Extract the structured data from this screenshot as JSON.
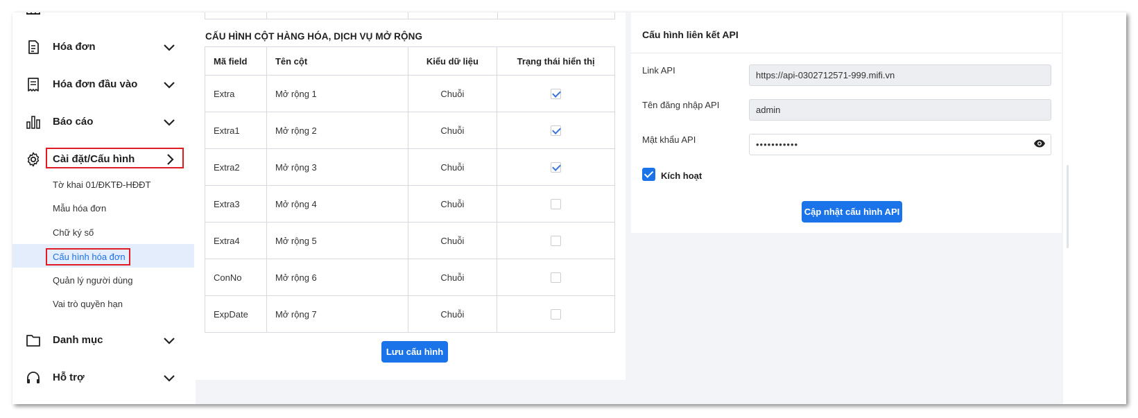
{
  "sidebar": {
    "partial_top_label": "...",
    "items": [
      {
        "label": "Hóa đơn",
        "icon": "receipt-icon"
      },
      {
        "label": "Hóa đơn đầu vào",
        "icon": "invoice-input-icon"
      },
      {
        "label": "Báo cáo",
        "icon": "bar-chart-icon"
      },
      {
        "label": "Cài đặt/Cấu hình",
        "icon": "gear-icon"
      },
      {
        "label": "Danh mục",
        "icon": "folder-icon"
      },
      {
        "label": "Hỗ trợ",
        "icon": "headset-icon"
      }
    ],
    "sub_items": [
      "Tờ khai 01/ĐKTĐ-HĐĐT",
      "Mẫu hóa đơn",
      "Chữ ký số",
      "Cấu hình hóa đơn",
      "Quản lý người dùng",
      "Vai trò quyền hạn"
    ],
    "active_sub_item": "Cấu hình hóa đơn"
  },
  "extended_columns": {
    "title": "CẤU HÌNH CỘT HÀNG HÓA, DỊCH VỤ MỞ RỘNG",
    "headers": [
      "Mã field",
      "Tên cột",
      "Kiểu dữ liệu",
      "Trạng thái hiển thị"
    ],
    "rows": [
      {
        "field": "Extra",
        "name": "Mở rộng 1",
        "type": "Chuỗi",
        "visible": true
      },
      {
        "field": "Extra1",
        "name": "Mở rộng 2",
        "type": "Chuỗi",
        "visible": true
      },
      {
        "field": "Extra2",
        "name": "Mở rộng 3",
        "type": "Chuỗi",
        "visible": true
      },
      {
        "field": "Extra3",
        "name": "Mở rộng 4",
        "type": "Chuỗi",
        "visible": false
      },
      {
        "field": "Extra4",
        "name": "Mở rộng 5",
        "type": "Chuỗi",
        "visible": false
      },
      {
        "field": "ConNo",
        "name": "Mở rộng 6",
        "type": "Chuỗi",
        "visible": false
      },
      {
        "field": "ExpDate",
        "name": "Mở rộng 7",
        "type": "Chuỗi",
        "visible": false
      }
    ],
    "save_button": "Lưu cấu hình"
  },
  "api_config": {
    "title": "Cấu hình liên kết API",
    "link_label": "Link API",
    "link_value": "https://api-0302712571-999.mifi.vn",
    "username_label": "Tên đăng nhập API",
    "username_value": "admin",
    "password_label": "Mật khẩu API",
    "password_value": "•••••••••••",
    "activate_label": "Kích hoạt",
    "activate_checked": true,
    "update_button": "Cập nhật cấu hình API"
  },
  "colors": {
    "primary": "#1a73e8",
    "highlight_border": "#e01b24",
    "active_bg": "#e3edfb"
  }
}
